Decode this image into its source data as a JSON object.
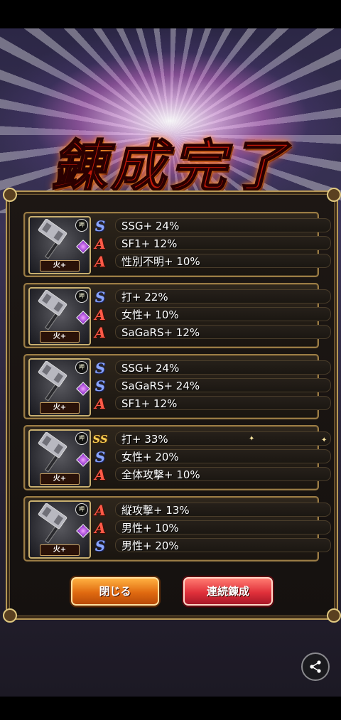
{
  "title": "錬成完了",
  "cards": [
    {
      "attribute": "火+",
      "rank_mark": "呷",
      "rows": [
        {
          "rank": "S",
          "text": "SSG+ 24%"
        },
        {
          "rank": "A",
          "text": "SF1+ 12%"
        },
        {
          "rank": "A",
          "text": "性別不明+ 10%"
        }
      ]
    },
    {
      "attribute": "火+",
      "rank_mark": "呷",
      "rows": [
        {
          "rank": "S",
          "text": "打+ 22%"
        },
        {
          "rank": "A",
          "text": "女性+ 10%"
        },
        {
          "rank": "A",
          "text": "SaGaRS+ 12%"
        }
      ]
    },
    {
      "attribute": "火+",
      "rank_mark": "呷",
      "rows": [
        {
          "rank": "S",
          "text": "SSG+ 24%"
        },
        {
          "rank": "S",
          "text": "SaGaRS+ 24%"
        },
        {
          "rank": "A",
          "text": "SF1+ 12%"
        }
      ]
    },
    {
      "attribute": "火+",
      "rank_mark": "呷",
      "rows": [
        {
          "rank": "SS",
          "text": "打+ 33%"
        },
        {
          "rank": "S",
          "text": "女性+ 20%"
        },
        {
          "rank": "A",
          "text": "全体攻撃+ 10%"
        }
      ]
    },
    {
      "attribute": "火+",
      "rank_mark": "呷",
      "rows": [
        {
          "rank": "A",
          "text": "縦攻撃+ 13%"
        },
        {
          "rank": "A",
          "text": "男性+ 10%"
        },
        {
          "rank": "S",
          "text": "男性+ 20%"
        }
      ]
    }
  ],
  "buttons": {
    "close_label": "閉じる",
    "continue_label": "連続錬成"
  },
  "icons": {
    "share": "share-icon",
    "weapon": "hammer-icon"
  },
  "colors": {
    "rank_s": "#8aa6ff",
    "rank_a": "#ff5a48",
    "rank_ss": "#ffcf50",
    "panel_border": "#b79855"
  }
}
